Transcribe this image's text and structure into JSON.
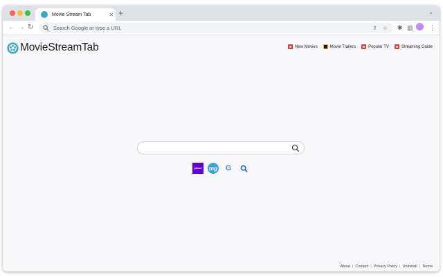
{
  "browser": {
    "tab_title": "Movie Stream Tab",
    "tab_close": "✕",
    "new_tab": "+",
    "tab_menu": "⌄",
    "back": "←",
    "forward": "→",
    "reload": "↻",
    "omnibox_placeholder": "Search Google or type a URL",
    "share": "⇪",
    "bookmark": "☆",
    "extensions": "✱",
    "sidepanel": "▥",
    "menu": "⋮"
  },
  "page": {
    "logo_text": "MovieStreamTab",
    "top_links": [
      {
        "label": "New Movies",
        "icon": "red-play-icon"
      },
      {
        "label": "Movie Trailers",
        "icon": "clapper-icon"
      },
      {
        "label": "Popular TV",
        "icon": "red-tv-icon"
      },
      {
        "label": "Streaming Guide",
        "icon": "red-guide-icon"
      }
    ],
    "search": {
      "placeholder": "",
      "value": ""
    },
    "engines": [
      {
        "label": "yahoo!",
        "name": "yahoo-icon"
      },
      {
        "label": "mg",
        "name": "mg-icon"
      },
      {
        "label": "G",
        "name": "google-icon"
      },
      {
        "label": "",
        "name": "search-engine-icon"
      }
    ],
    "footer": [
      "About",
      "Contact",
      "Privacy Policy",
      "Uninstall",
      "Terms"
    ],
    "footer_sep": "|"
  },
  "colors": {
    "accent": "#3aa6c8",
    "link_icon_red": "#e53935",
    "yahoo": "#6001d2"
  }
}
